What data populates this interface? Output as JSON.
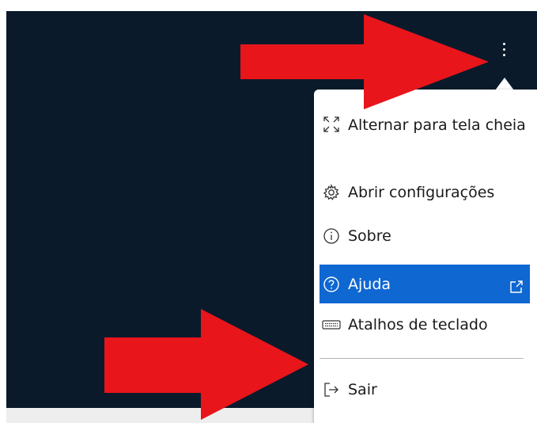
{
  "menu": {
    "items": [
      {
        "label": "Alternar para tela cheia",
        "icon": "fullscreen-icon"
      },
      {
        "label": "Abrir configurações",
        "icon": "settings-gear-icon"
      },
      {
        "label": "Sobre",
        "icon": "info-icon"
      },
      {
        "label": "Ajuda",
        "icon": "help-icon",
        "trailing_icon": "external-link-icon",
        "highlighted": true
      },
      {
        "label": "Atalhos de teclado",
        "icon": "keyboard-icon"
      },
      {
        "label": "Sair",
        "icon": "sign-out-icon"
      }
    ]
  },
  "colors": {
    "app_background": "#0a1a2b",
    "menu_background": "#ffffff",
    "highlight": "#0f67d1",
    "annotation_arrow": "#e8151b",
    "bottom_strip": "#eeeeef"
  }
}
